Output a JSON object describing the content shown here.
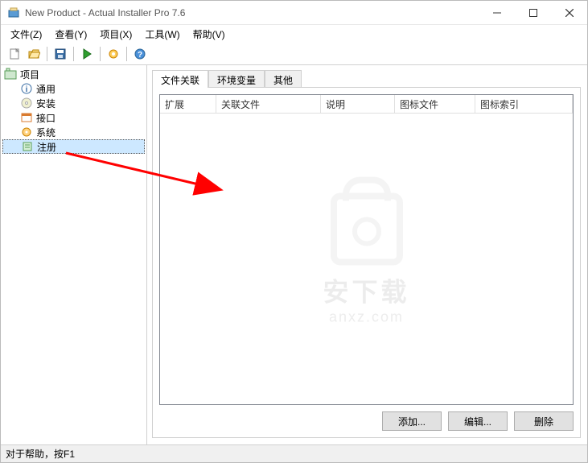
{
  "title": "New Product - Actual Installer Pro 7.6",
  "menus": [
    "文件(Z)",
    "查看(Y)",
    "项目(X)",
    "工具(W)",
    "帮助(V)"
  ],
  "tree": {
    "root": "项目",
    "items": [
      {
        "label": "通用",
        "icon": "info"
      },
      {
        "label": "安装",
        "icon": "cd"
      },
      {
        "label": "接口",
        "icon": "window"
      },
      {
        "label": "系统",
        "icon": "gear"
      },
      {
        "label": "注册",
        "icon": "reg",
        "selected": true
      }
    ]
  },
  "tabs": [
    "文件关联",
    "环境变量",
    "其他"
  ],
  "active_tab": 0,
  "list_columns": [
    "扩展",
    "关联文件",
    "说明",
    "图标文件",
    "图标索引"
  ],
  "buttons": {
    "add": "添加...",
    "edit": "编辑...",
    "delete": "删除"
  },
  "status": "对于帮助，按F1",
  "watermark": {
    "cn": "安下载",
    "en": "anxz.com"
  }
}
